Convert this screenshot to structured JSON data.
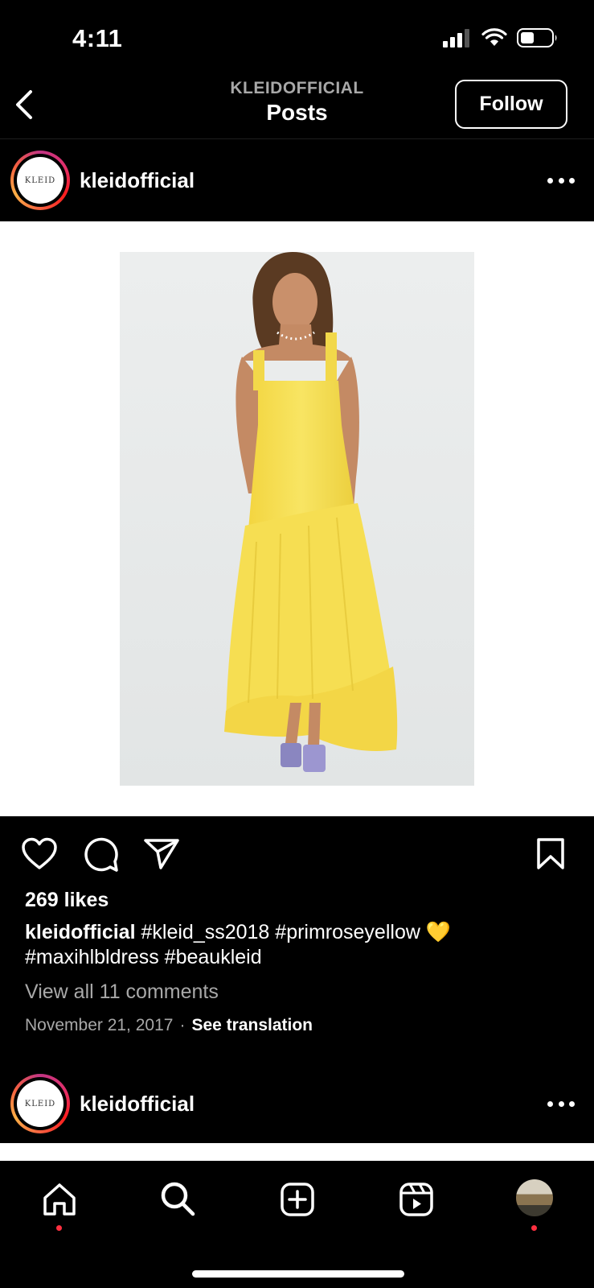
{
  "status": {
    "time": "4:11"
  },
  "header": {
    "subtitle": "KLEIDOFFICIAL",
    "title": "Posts",
    "follow_label": "Follow"
  },
  "post": {
    "username": "kleidofficial",
    "avatar_text": "KLEID",
    "likes": "269 likes",
    "caption_user": "kleidofficial",
    "caption_line1": "#kleid_ss2018 #primroseyellow 💛",
    "caption_line2": "#maxihlbldress #beaukleid",
    "view_comments": "View all 11 comments",
    "date": "November 21, 2017",
    "separator": "·",
    "see_translation": "See translation"
  },
  "next_post": {
    "username": "kleidofficial",
    "avatar_text": "KLEID"
  },
  "icons": {
    "back": "chevron-left-icon",
    "more": "more-horizontal-icon",
    "like": "heart-icon",
    "comment": "comment-icon",
    "share": "send-icon",
    "save": "bookmark-icon",
    "home": "home-icon",
    "search": "search-icon",
    "create": "plus-square-icon",
    "reels": "reels-icon",
    "profile": "profile-avatar"
  },
  "colors": {
    "background": "#000000",
    "follow_border": "#ffffff",
    "muted_text": "#a8a8a8",
    "notification_dot": "#ff3040",
    "dress": "#f7e15a"
  }
}
